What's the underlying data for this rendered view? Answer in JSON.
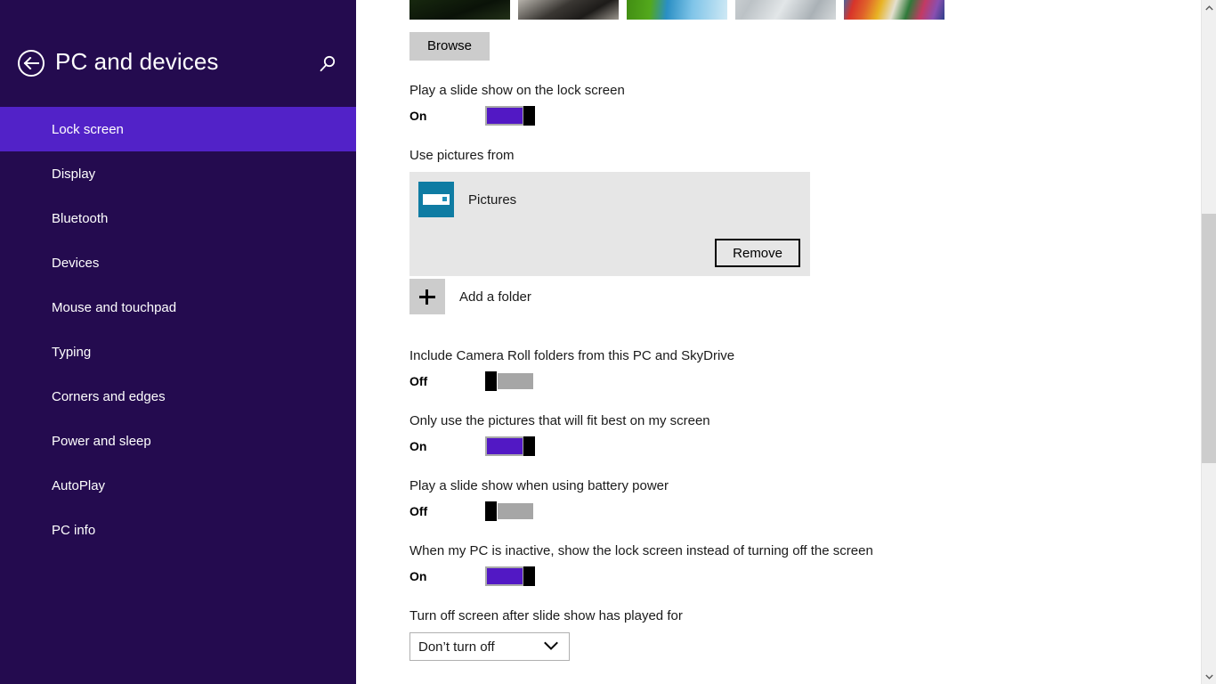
{
  "sidebar": {
    "title": "PC and devices",
    "back_icon": "back-arrow-icon",
    "search_icon": "search-icon",
    "items": [
      {
        "label": "Lock screen",
        "selected": true
      },
      {
        "label": "Display",
        "selected": false
      },
      {
        "label": "Bluetooth",
        "selected": false
      },
      {
        "label": "Devices",
        "selected": false
      },
      {
        "label": "Mouse and touchpad",
        "selected": false
      },
      {
        "label": "Typing",
        "selected": false
      },
      {
        "label": "Corners and edges",
        "selected": false
      },
      {
        "label": "Power and sleep",
        "selected": false
      },
      {
        "label": "AutoPlay",
        "selected": false
      },
      {
        "label": "PC info",
        "selected": false
      }
    ]
  },
  "main": {
    "browse_button": "Browse",
    "thumbnails_count": 5,
    "slideshow": {
      "label": "Play a slide show on the lock screen",
      "state": "On"
    },
    "use_pictures_from": {
      "label": "Use pictures from",
      "folder_name": "Pictures",
      "folder_icon": "pictures-library-icon",
      "remove_button": "Remove",
      "add_folder_label": "Add a folder",
      "add_folder_icon": "plus-icon"
    },
    "camera_roll": {
      "label": "Include Camera Roll folders from this PC and SkyDrive",
      "state": "Off"
    },
    "fit_best": {
      "label": "Only use the pictures that will fit best on my screen",
      "state": "On"
    },
    "battery_power": {
      "label": "Play a slide show when using battery power",
      "state": "Off"
    },
    "inactive_lock": {
      "label": "When my PC is inactive, show the lock screen instead of turning off the screen",
      "state": "On"
    },
    "turn_off_screen": {
      "label": "Turn off screen after slide show has played for",
      "selected_option": "Don’t turn off",
      "chevron_icon": "chevron-down-icon"
    }
  },
  "scrollbar": {
    "up_icon": "chevron-up-icon",
    "down_icon": "chevron-down-icon"
  },
  "colors": {
    "sidebar_bg": "#240b4f",
    "sidebar_selected": "#5222c8",
    "toggle_on": "#5218c4",
    "pictures_icon": "#0f7ca3"
  }
}
